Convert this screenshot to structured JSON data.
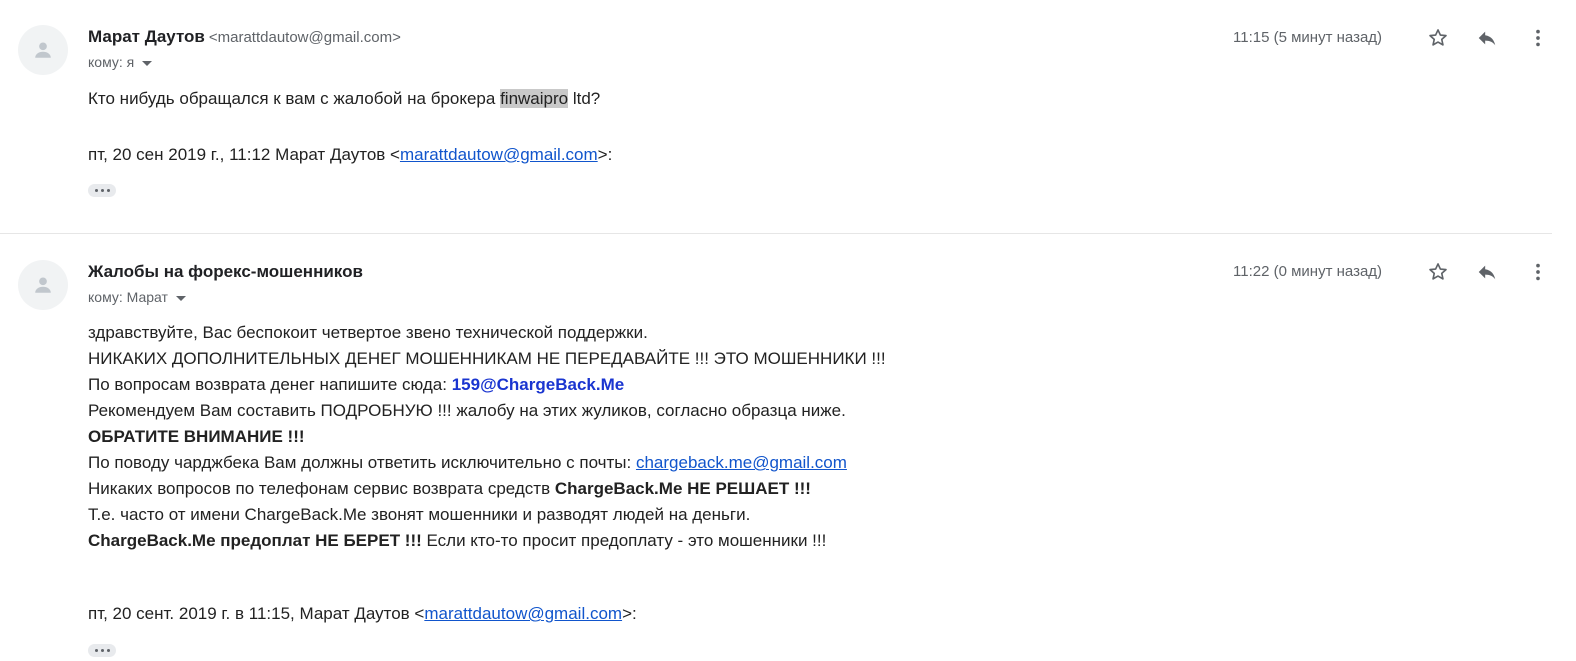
{
  "messages": [
    {
      "sender_name": "Марат Даутов",
      "sender_email": "<marattdautow@gmail.com>",
      "recipient": "кому: я",
      "time": "11:15 (5 минут назад)",
      "body_line1_prefix": "Кто нибудь обращался к вам с жалобой на брокера ",
      "body_line1_highlight": "finwaipro",
      "body_line1_suffix": " ltd?",
      "quote_prefix": "пт, 20 сен 2019 г., 11:12 Марат Даутов <",
      "quote_email": "marattdautow@gmail.com",
      "quote_suffix": ">:"
    },
    {
      "sender_name": "Жалобы на форекс-мошенников",
      "recipient": "кому: Марат",
      "time": "11:22 (0 минут назад)",
      "line1": "здравствуйте, Вас беспокоит четвертое звено технической поддержки.",
      "line2": "НИКАКИХ ДОПОЛНИТЕЛЬНЫХ ДЕНЕГ МОШЕННИКАМ НЕ ПЕРЕДАВАЙТЕ !!! ЭТО МОШЕННИКИ !!!",
      "line3_prefix": "По вопросам возврата денег напишите сюда: ",
      "line3_email": "159@ChargeBack.Me",
      "line4": "Рекомендуем Вам составить ПОДРОБНУЮ !!! жалобу на этих жуликов, согласно образца ниже.",
      "line5": "ОБРАТИТЕ ВНИМАНИЕ !!!",
      "line6_prefix": "По поводу чарджбека Вам должны ответить исключительно с почты: ",
      "line6_email": "chargeback.me@gmail.com",
      "line7_prefix": "Никаких вопросов по телефонам сервис возврата средств ",
      "line7_bold": "ChargeBack.Me НЕ РЕШАЕТ !!!",
      "line8": "Т.е. часто от имени ChargeBack.Me звонят мошенники и разводят людей на деньги.",
      "line9_bold": "ChargeBack.Me предоплат НЕ БЕРЕТ !!!",
      "line9_suffix": " Если кто-то просит предоплату - это мошенники !!!",
      "quote_prefix": "пт, 20 сент. 2019 г. в 11:15, Марат Даутов <",
      "quote_email": "marattdautow@gmail.com",
      "quote_suffix": ">:"
    }
  ],
  "icons": {
    "avatar": "person-icon",
    "star": "star-icon",
    "reply": "reply-icon",
    "more": "more-vert-icon",
    "expand": "ellipsis-icon",
    "recipient_details": "caret-down-icon"
  },
  "colors": {
    "link": "#1155cc",
    "highlight": "#c9c9c9",
    "support_email": "#1a35d0"
  }
}
